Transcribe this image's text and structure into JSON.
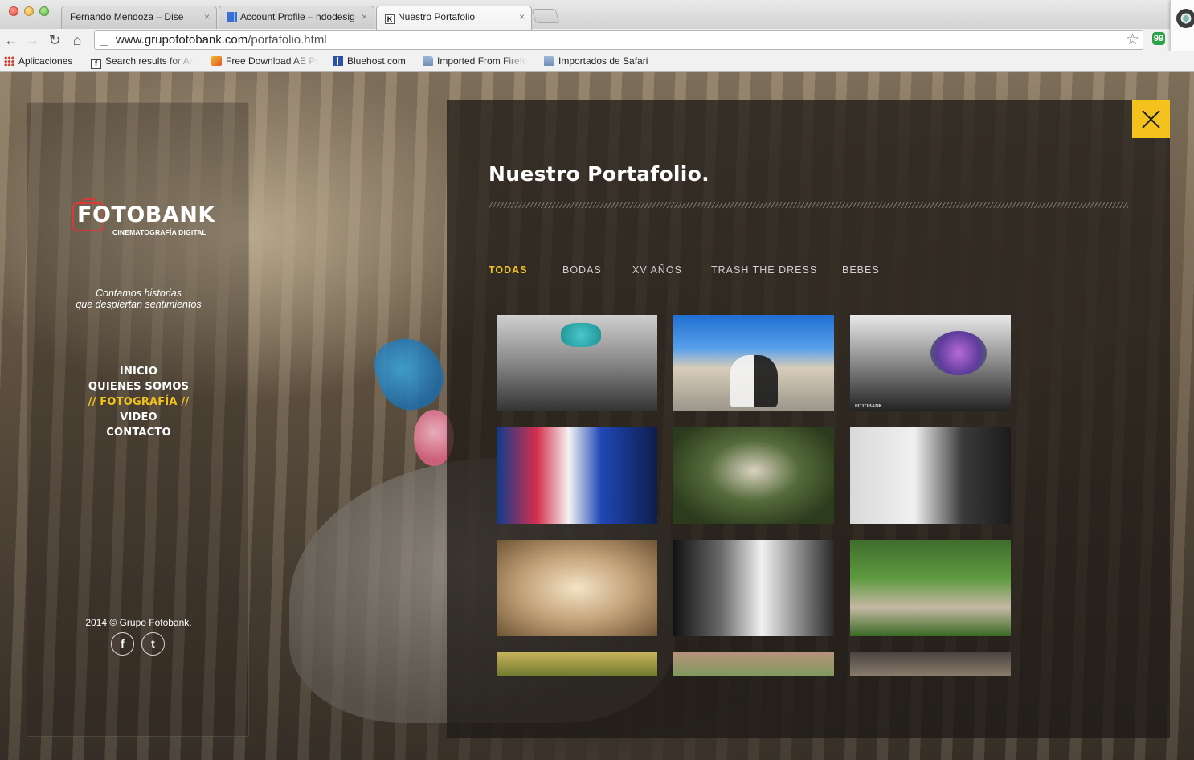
{
  "browser": {
    "tabs": [
      {
        "title": "Fernando Mendoza – Dise",
        "favicon": "person-favicon",
        "active": false
      },
      {
        "title": "Account Profile – ndodesig",
        "favicon": "grid-favicon",
        "active": false
      },
      {
        "title": "Nuestro Portafolio",
        "favicon": "k-favicon",
        "active": true
      }
    ],
    "tab_close_glyph": "×",
    "url_host": "www.grupofotobank.com",
    "url_path": "/portafolio.html",
    "nav_icons": [
      "back-arrow-icon",
      "forward-arrow-icon",
      "reload-icon",
      "home-icon"
    ],
    "bookmarks": [
      {
        "label": "Aplicaciones",
        "icon": "apps-grid-icon"
      },
      {
        "label": "Search results for An",
        "icon": "fb-icon"
      },
      {
        "label": "Free Download AE Pr",
        "icon": "ae-icon"
      },
      {
        "label": "Bluehost.com",
        "icon": "bluehost-icon"
      },
      {
        "label": "Imported From Firefo",
        "icon": "folder-icon"
      },
      {
        "label": "Importados de Safari",
        "icon": "folder-icon"
      }
    ],
    "extension_glyph": "99"
  },
  "sidebar": {
    "logo_text": "FOTOBANK",
    "logo_sub": "CINEMATOGRAFÍA DIGITAL",
    "tagline_line1": "Contamos historias",
    "tagline_line2": "que despiertan sentimientos",
    "nav": [
      {
        "label": "INICIO",
        "active": false
      },
      {
        "label": "QUIENES SOMOS",
        "active": false
      },
      {
        "label": "// FOTOGRAFÍA //",
        "active": true
      },
      {
        "label": "VIDEO",
        "active": false
      },
      {
        "label": "CONTACTO",
        "active": false
      }
    ],
    "copyright": "2014 © Grupo Fotobank.",
    "social": {
      "facebook": "f",
      "twitter": "t"
    }
  },
  "portfolio": {
    "title": "Nuestro Portafolio.",
    "filters": [
      {
        "label": "TODAS",
        "active": true
      },
      {
        "label": "BODAS",
        "active": false
      },
      {
        "label": "XV AÑOS",
        "active": false
      },
      {
        "label": "TRASH THE DRESS",
        "active": false
      },
      {
        "label": "BEBES",
        "active": false
      }
    ],
    "thumbnail_watermark": "FOTOBANK",
    "accent_color": "#f3c21d"
  }
}
